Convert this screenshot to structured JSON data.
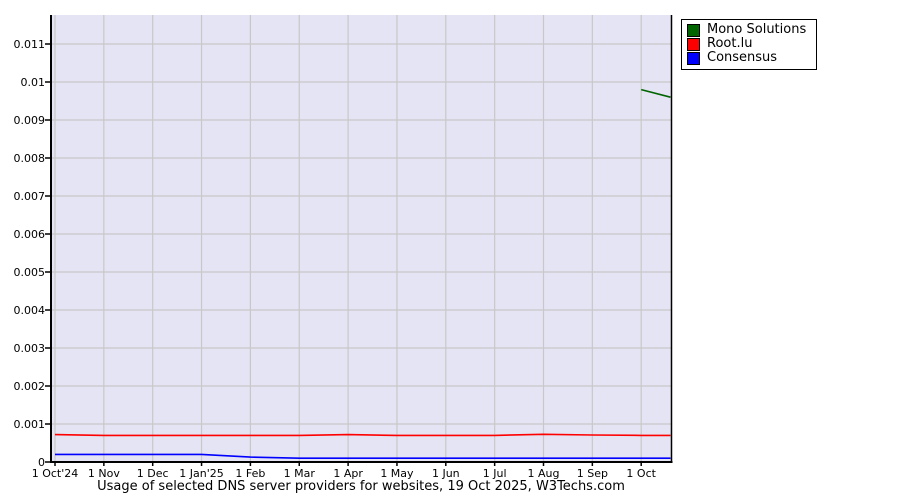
{
  "chart_data": {
    "type": "line",
    "title": "Usage of selected DNS server providers for websites, 19 Oct 2025, W3Techs.com",
    "xlabel": "",
    "ylabel": "",
    "x_tick_labels": [
      "1 Oct'24",
      "1 Nov",
      "1 Dec",
      "1 Jan'25",
      "1 Feb",
      "1 Mar",
      "1 Apr",
      "1 May",
      "1 Jun",
      "1 Jul",
      "1 Aug",
      "1 Sep",
      "1 Oct"
    ],
    "y_tick_labels": [
      "0",
      "0.001",
      "0.002",
      "0.003",
      "0.004",
      "0.005",
      "0.006",
      "0.007",
      "0.008",
      "0.009",
      "0.01",
      "0.011"
    ],
    "y_tick_values": [
      0,
      0.001,
      0.002,
      0.003,
      0.004,
      0.005,
      0.006,
      0.007,
      0.008,
      0.009,
      0.01,
      0.011
    ],
    "ylim": [
      0,
      0.01175
    ],
    "xlim_months": [
      0,
      12.63
    ],
    "grid": true,
    "legend_position": "outside-top-right",
    "colors": {
      "plot_background": "#e4e4f4",
      "grid_line": "#c8c8c8",
      "axis": "#000000",
      "outer_background": "#ffffff"
    },
    "series": [
      {
        "name": "Mono Solutions",
        "color": "#006400",
        "points": [
          {
            "m": 12,
            "v": 0.0098
          },
          {
            "m": 12.6,
            "v": 0.0096
          }
        ]
      },
      {
        "name": "Root.lu",
        "color": "#ff0000",
        "points": [
          {
            "m": 0,
            "v": 0.00072
          },
          {
            "m": 1,
            "v": 0.0007
          },
          {
            "m": 2,
            "v": 0.0007
          },
          {
            "m": 3,
            "v": 0.0007
          },
          {
            "m": 4,
            "v": 0.0007
          },
          {
            "m": 5,
            "v": 0.0007
          },
          {
            "m": 6,
            "v": 0.00072
          },
          {
            "m": 7,
            "v": 0.0007
          },
          {
            "m": 8,
            "v": 0.0007
          },
          {
            "m": 9,
            "v": 0.0007
          },
          {
            "m": 10,
            "v": 0.00073
          },
          {
            "m": 11,
            "v": 0.00071
          },
          {
            "m": 12,
            "v": 0.0007
          },
          {
            "m": 12.6,
            "v": 0.0007
          }
        ]
      },
      {
        "name": "Consensus",
        "color": "#0000ff",
        "points": [
          {
            "m": 0,
            "v": 0.0002
          },
          {
            "m": 1,
            "v": 0.0002
          },
          {
            "m": 2,
            "v": 0.0002
          },
          {
            "m": 3,
            "v": 0.0002
          },
          {
            "m": 4,
            "v": 0.00013
          },
          {
            "m": 5,
            "v": 0.0001
          },
          {
            "m": 6,
            "v": 0.0001
          },
          {
            "m": 7,
            "v": 0.0001
          },
          {
            "m": 8,
            "v": 0.0001
          },
          {
            "m": 9,
            "v": 0.0001
          },
          {
            "m": 10,
            "v": 0.0001
          },
          {
            "m": 11,
            "v": 0.0001
          },
          {
            "m": 12,
            "v": 0.0001
          },
          {
            "m": 12.6,
            "v": 0.0001
          }
        ]
      }
    ]
  }
}
